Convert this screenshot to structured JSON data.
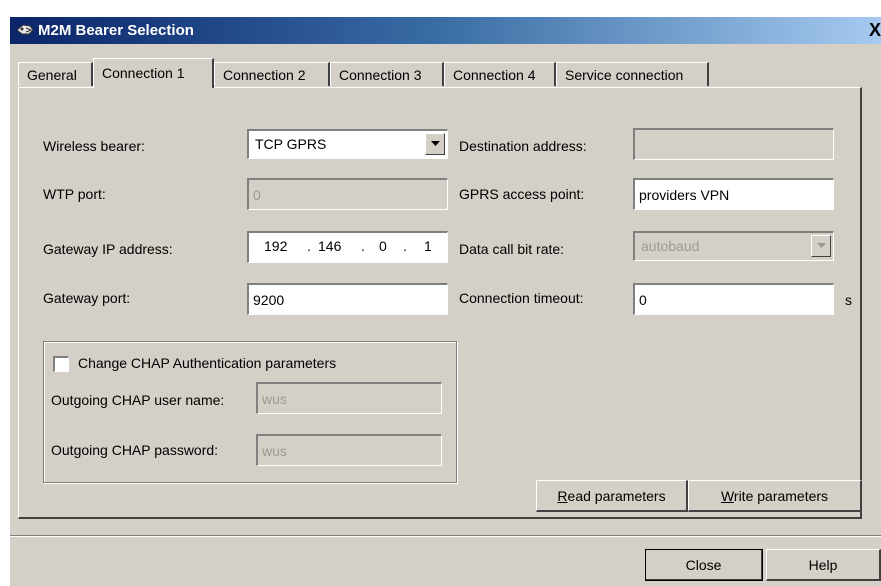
{
  "window": {
    "title": "M2M Bearer Selection",
    "close_glyph": "X"
  },
  "tabs": [
    {
      "label": "General"
    },
    {
      "label": "Connection 1"
    },
    {
      "label": "Connection 2"
    },
    {
      "label": "Connection 3"
    },
    {
      "label": "Connection 4"
    },
    {
      "label": "Service connection"
    }
  ],
  "form": {
    "wireless_bearer": {
      "label": "Wireless bearer:",
      "value": "TCP GPRS"
    },
    "wtp_port": {
      "label": "WTP port:",
      "value": "0"
    },
    "gateway_ip": {
      "label": "Gateway IP address:",
      "octets": [
        "192",
        "146",
        "0",
        "1"
      ],
      "dot": "."
    },
    "gateway_port": {
      "label": "Gateway port:",
      "value": "9200"
    },
    "destination_address": {
      "label": "Destination address:",
      "value": ""
    },
    "gprs_access_point": {
      "label": "GPRS access point:",
      "value": "providers VPN"
    },
    "data_call_bit_rate": {
      "label": "Data call bit rate:",
      "value": "autobaud"
    },
    "connection_timeout": {
      "label": "Connection timeout:",
      "value": "0",
      "unit": "s"
    }
  },
  "chap": {
    "checkbox_label": "Change CHAP Authentication parameters",
    "checked": false,
    "user_name": {
      "label": "Outgoing CHAP user name:",
      "value": "wus"
    },
    "password": {
      "label": "Outgoing CHAP password:",
      "value": "wus"
    }
  },
  "buttons": {
    "read_prefix": "R",
    "read_rest": "ead parameters",
    "write_prefix": "W",
    "write_rest": "rite parameters",
    "close": "Close",
    "help": "Help"
  }
}
